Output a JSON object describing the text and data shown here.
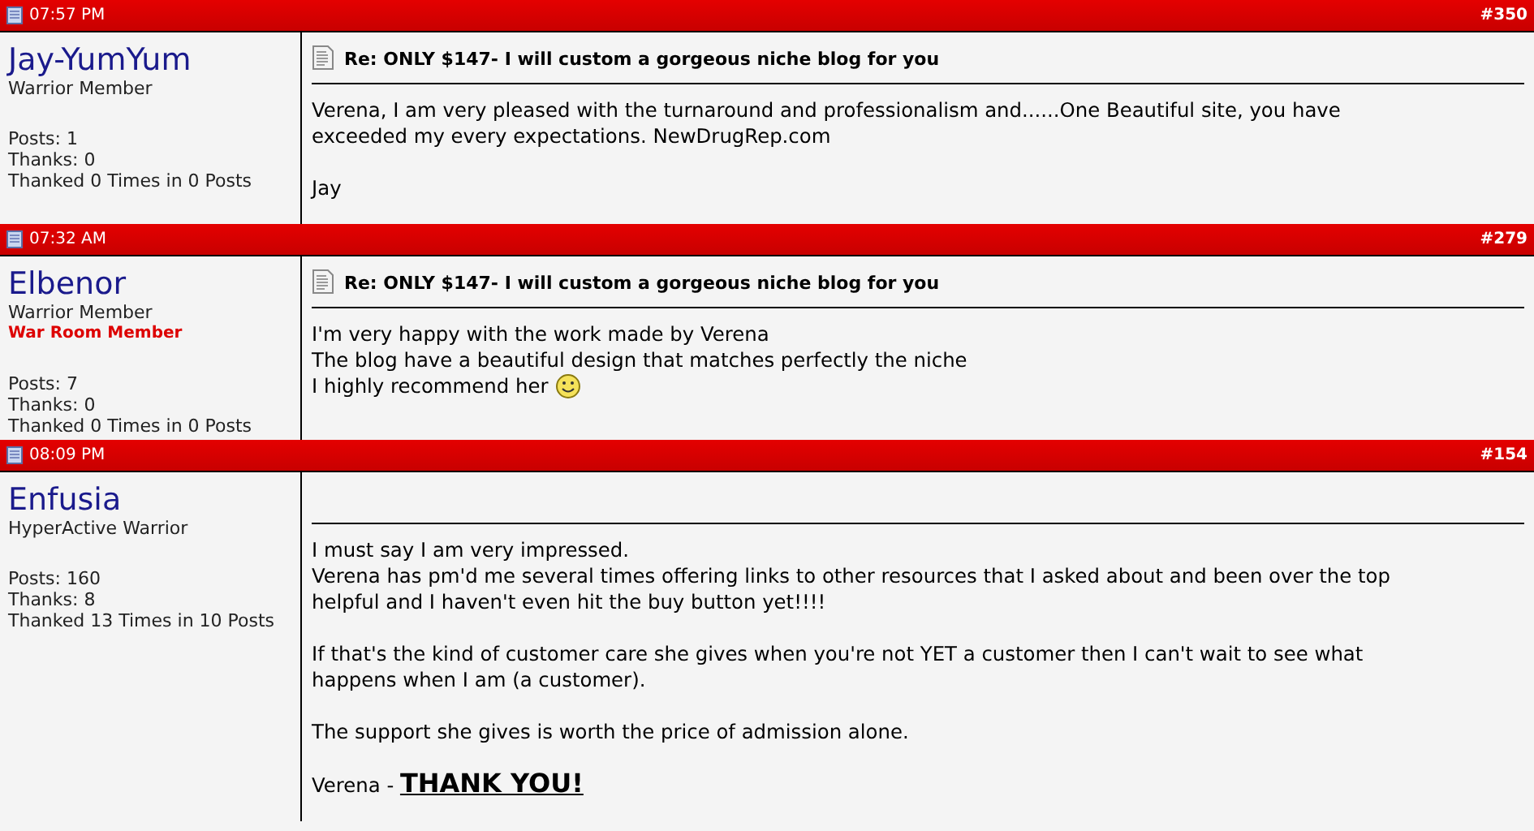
{
  "posts": [
    {
      "time": "07:57 PM",
      "number": "#350",
      "user": {
        "name": "Jay-YumYum",
        "rank": "Warrior Member",
        "stats": [
          "Posts: 1",
          "Thanks: 0",
          "Thanked 0 Times in 0 Posts"
        ]
      },
      "title": "Re: ONLY $147- I will custom a gorgeous niche blog for you",
      "paragraphs": [
        {
          "lines": [
            "Verena, I am very pleased with the turnaround and professionalism and......One Beautiful site, you have",
            "exceeded my every expectations. NewDrugRep.com"
          ]
        },
        {
          "lines": [
            "Jay"
          ]
        }
      ]
    },
    {
      "time": "07:32 AM",
      "number": "#279",
      "user": {
        "name": "Elbenor",
        "rank": "Warrior Member",
        "badge": "War Room Member",
        "stats": [
          "Posts: 7",
          "Thanks: 0",
          "Thanked 0 Times in 0 Posts"
        ]
      },
      "title": "Re: ONLY $147- I will custom a gorgeous niche blog for you",
      "paragraphs": [
        {
          "lines": [
            "I'm very happy with the work made by Verena",
            "The blog have a beautiful design that matches perfectly the niche",
            "I highly recommend her"
          ],
          "smiley": true
        }
      ]
    },
    {
      "time": "08:09 PM",
      "number": "#154",
      "user": {
        "name": "Enfusia",
        "rank": "HyperActive Warrior",
        "stats": [
          "Posts: 160",
          "Thanks: 8",
          "Thanked 13 Times in 10 Posts"
        ]
      },
      "paragraphs": [
        {
          "lines": [
            "I must say I am very impressed.",
            "Verena has pm'd me several times offering links to other resources that I asked about and been over the top",
            "helpful and I haven't even hit the buy button yet!!!!"
          ]
        },
        {
          "lines": [
            "If that's the kind of customer care she gives when you're not YET a customer then I can't wait to see what",
            "happens when I am (a customer)."
          ]
        },
        {
          "lines": [
            "The support she gives is worth the price of admission alone."
          ]
        },
        {
          "lines": [
            "Verena - **THANK YOU!**"
          ]
        }
      ]
    }
  ]
}
